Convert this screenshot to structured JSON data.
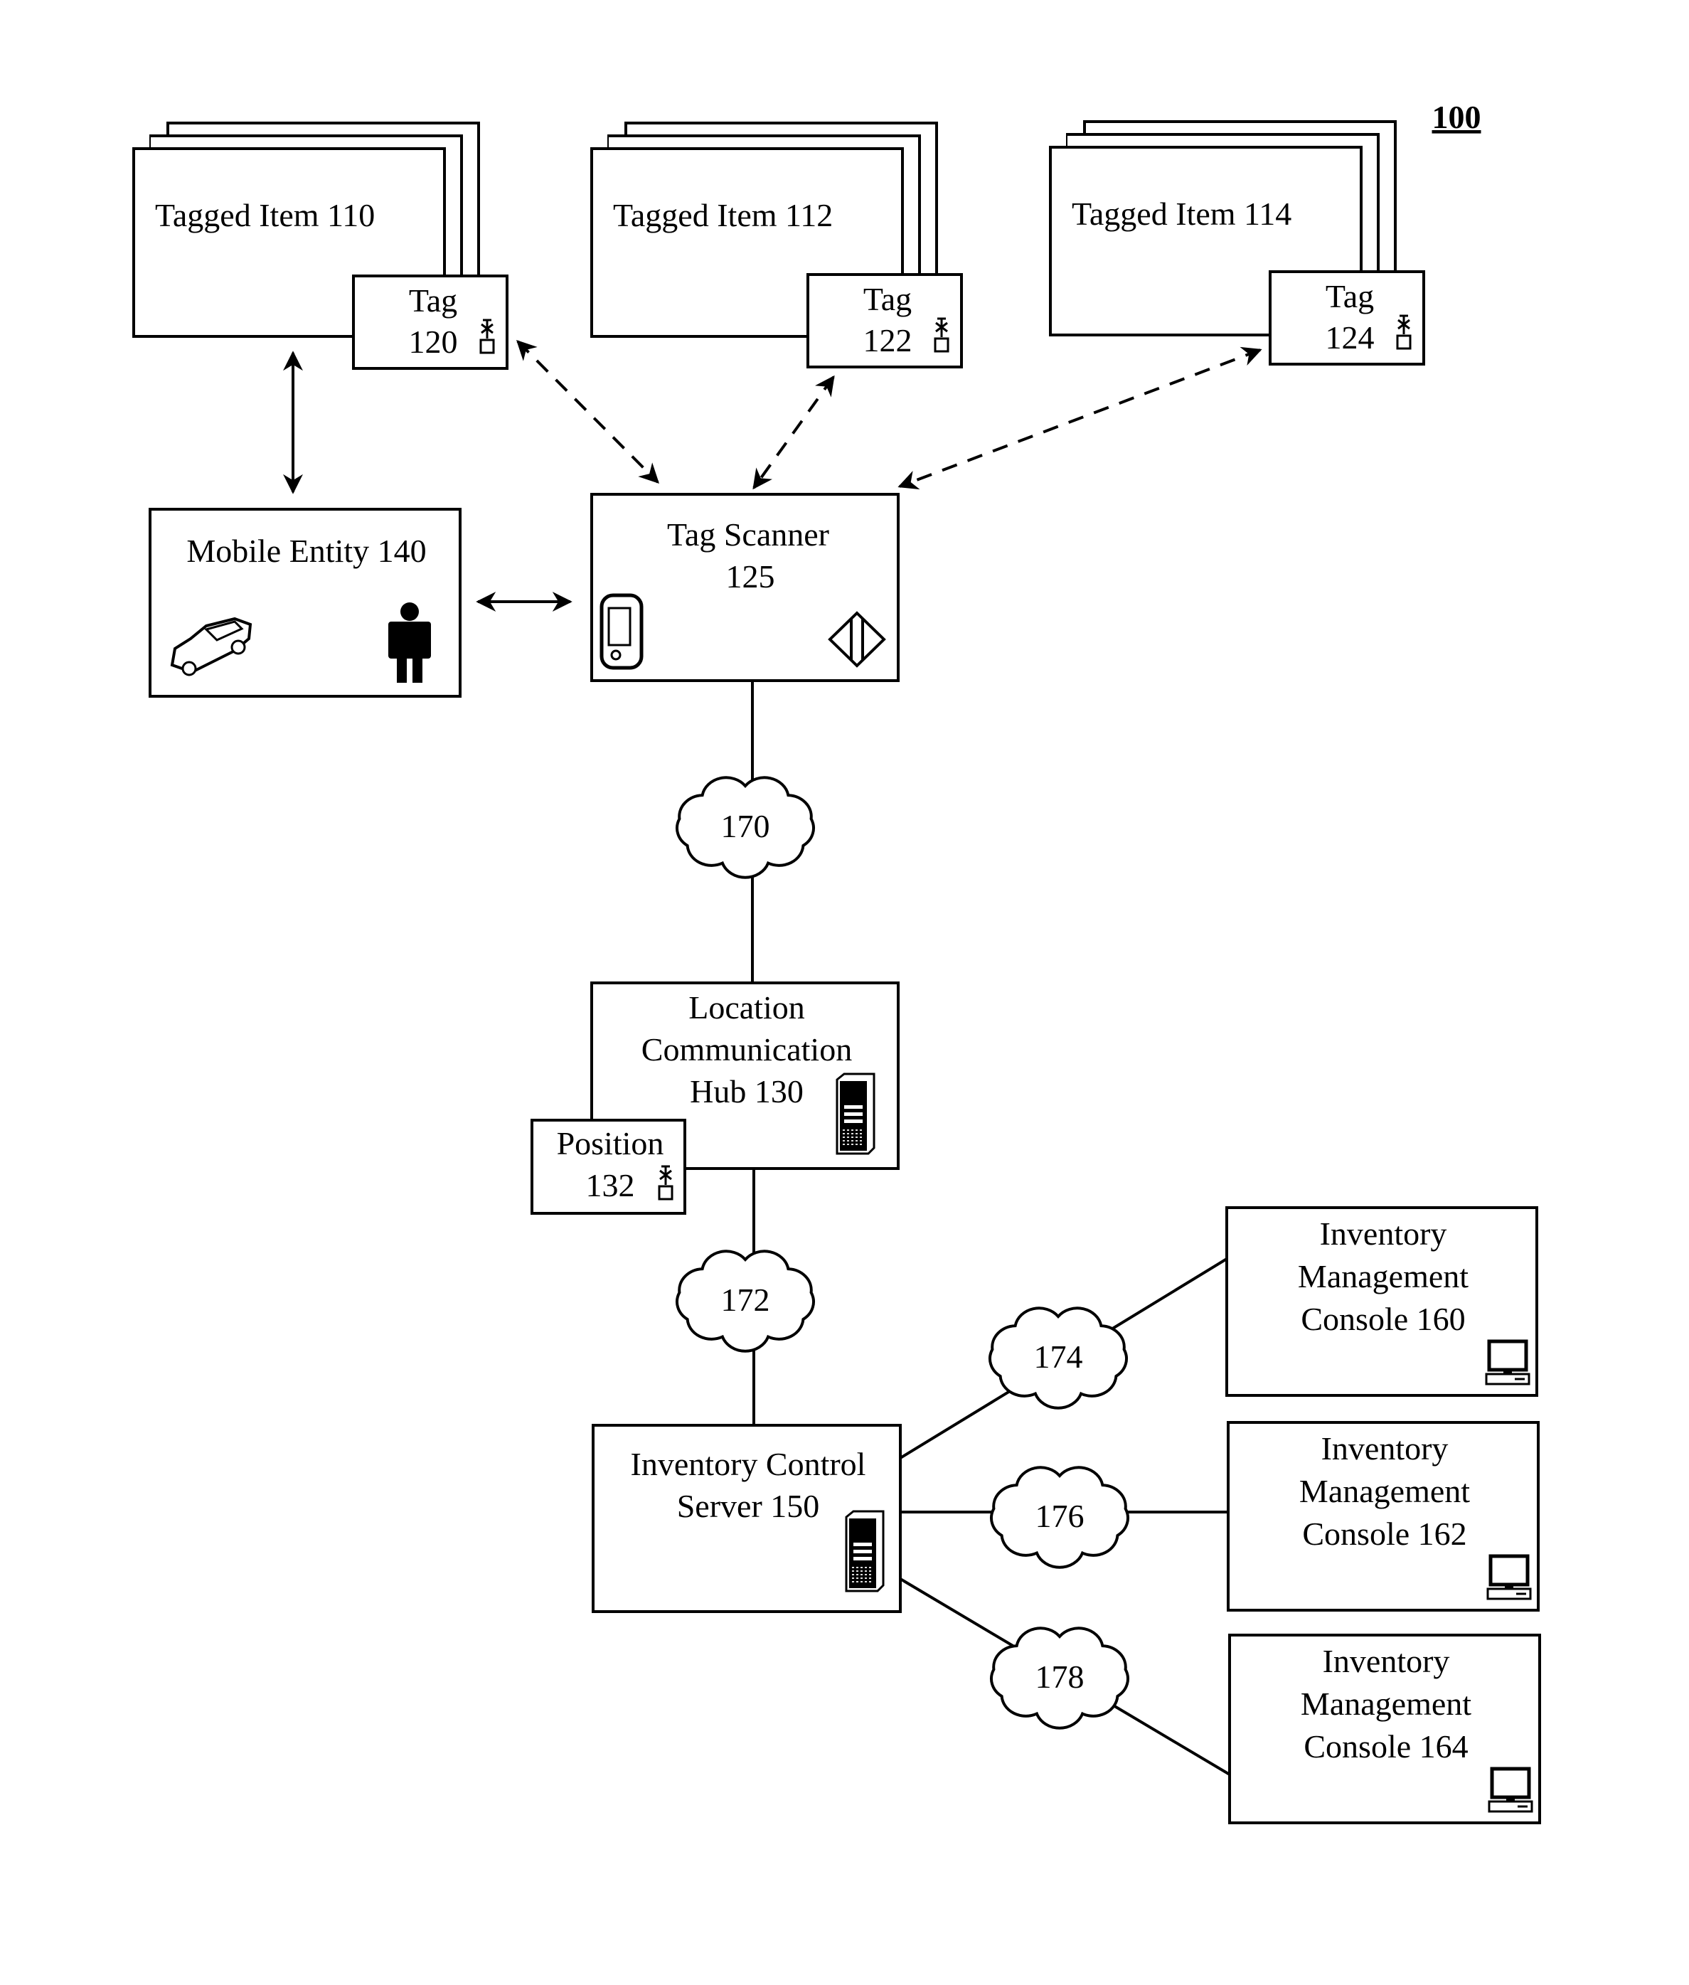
{
  "figure_label": "100",
  "tagged_items": [
    {
      "id": "tagged-item-110",
      "label": "Tagged Item 110",
      "tag": {
        "line1": "Tag",
        "line2": "120"
      }
    },
    {
      "id": "tagged-item-112",
      "label": "Tagged Item 112",
      "tag": {
        "line1": "Tag",
        "line2": "122"
      }
    },
    {
      "id": "tagged-item-114",
      "label": "Tagged Item 114",
      "tag": {
        "line1": "Tag",
        "line2": "124"
      }
    }
  ],
  "mobile_entity": {
    "label": "Mobile Entity 140",
    "icons": [
      "car-icon",
      "person-icon"
    ]
  },
  "tag_scanner": {
    "line1": "Tag Scanner",
    "line2": "125",
    "icons": [
      "handheld-device-icon",
      "diamond-scanner-icon"
    ]
  },
  "hub": {
    "lines": [
      "Location",
      "Communication",
      "Hub 130"
    ],
    "icon": "server-tower-icon"
  },
  "position": {
    "line1": "Position",
    "line2": "132",
    "icon": "antenna-tag-icon"
  },
  "server": {
    "lines": [
      "Inventory Control",
      "Server 150"
    ],
    "icon": "server-tower-icon"
  },
  "consoles": [
    {
      "lines": [
        "Inventory",
        "Management",
        "Console 160"
      ],
      "icon": "desktop-computer-icon"
    },
    {
      "lines": [
        "Inventory",
        "Management",
        "Console 162"
      ],
      "icon": "desktop-computer-icon"
    },
    {
      "lines": [
        "Inventory",
        "Management",
        "Console 164"
      ],
      "icon": "desktop-computer-icon"
    }
  ],
  "networks": [
    "170",
    "172",
    "174",
    "176",
    "178"
  ],
  "connections": [
    {
      "from": "tag-120",
      "to": "tag-scanner-125",
      "style": "dashed",
      "bidirectional": true
    },
    {
      "from": "tag-122",
      "to": "tag-scanner-125",
      "style": "dashed",
      "bidirectional": true
    },
    {
      "from": "tag-124",
      "to": "tag-scanner-125",
      "style": "dashed",
      "bidirectional": true
    },
    {
      "from": "tagged-item-110",
      "to": "mobile-entity-140",
      "style": "solid",
      "bidirectional": true
    },
    {
      "from": "mobile-entity-140",
      "to": "tag-scanner-125",
      "style": "solid",
      "bidirectional": true
    },
    {
      "from": "tag-scanner-125",
      "to": "hub-130",
      "via": "170",
      "style": "solid"
    },
    {
      "from": "hub-130",
      "to": "server-150",
      "via": "172",
      "style": "solid"
    },
    {
      "from": "server-150",
      "to": "console-160",
      "via": "174",
      "style": "solid"
    },
    {
      "from": "server-150",
      "to": "console-162",
      "via": "176",
      "style": "solid"
    },
    {
      "from": "server-150",
      "to": "console-164",
      "via": "178",
      "style": "solid"
    }
  ]
}
